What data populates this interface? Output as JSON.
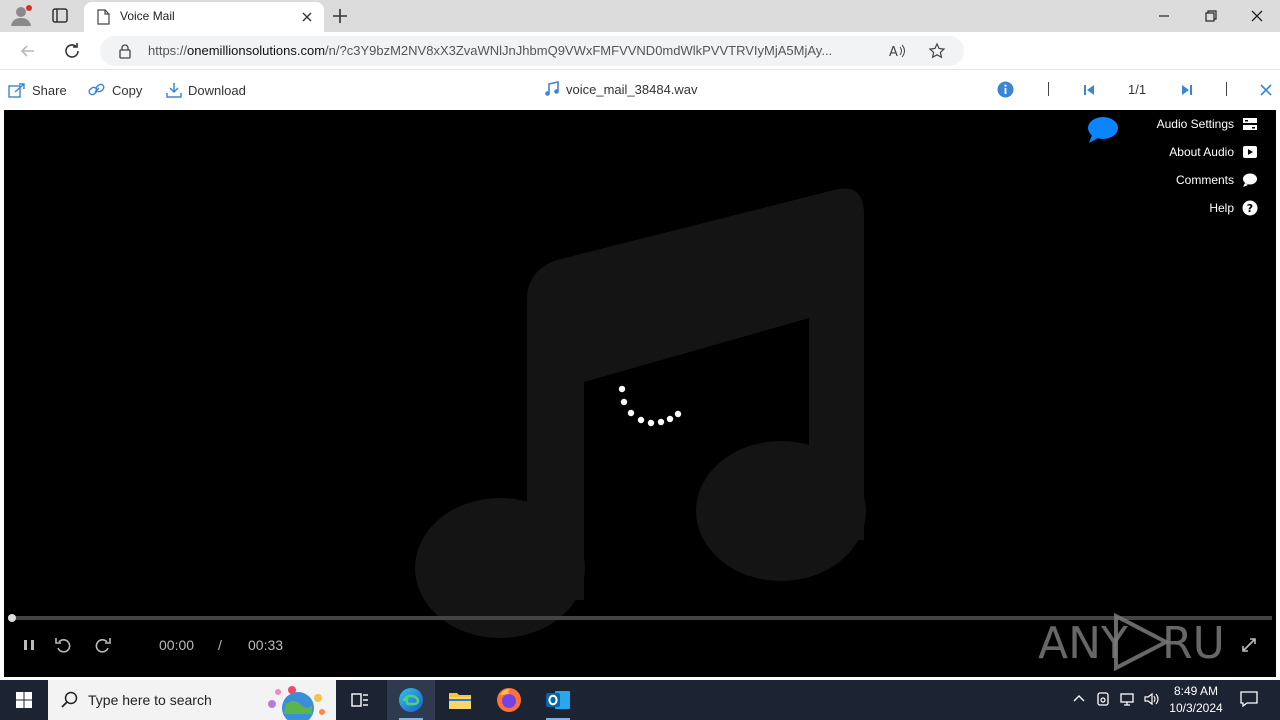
{
  "browser": {
    "tab_title": "Voice Mail",
    "url_domain": "onemillionsolutions.com",
    "url_prefix": "https://",
    "url_rest": "/n/?c3Y9bzM2NV8xX3ZvaWNlJnJhbmQ9VWxFMFVVND0mdWlkPVVTRVIyMjA5MjAy..."
  },
  "viewer": {
    "share_label": "Share",
    "copy_label": "Copy",
    "download_label": "Download",
    "filename": "voice_mail_38484.wav",
    "page_indicator": "1/1"
  },
  "player": {
    "menu": {
      "audio_settings": "Audio Settings",
      "about_audio": "About Audio",
      "comments": "Comments",
      "help": "Help"
    },
    "current_time": "00:00",
    "time_separator": "/",
    "duration": "00:33",
    "progress_fraction": 0,
    "watermark": "ANY RUN"
  },
  "taskbar": {
    "search_placeholder": "Type here to search",
    "time": "8:49 AM",
    "date": "10/3/2024"
  },
  "colors": {
    "accent_blue": "#1a73e8",
    "chat_bubble": "#0a84ff",
    "player_bg": "#000000",
    "taskbar_bg": "#1c2333"
  }
}
